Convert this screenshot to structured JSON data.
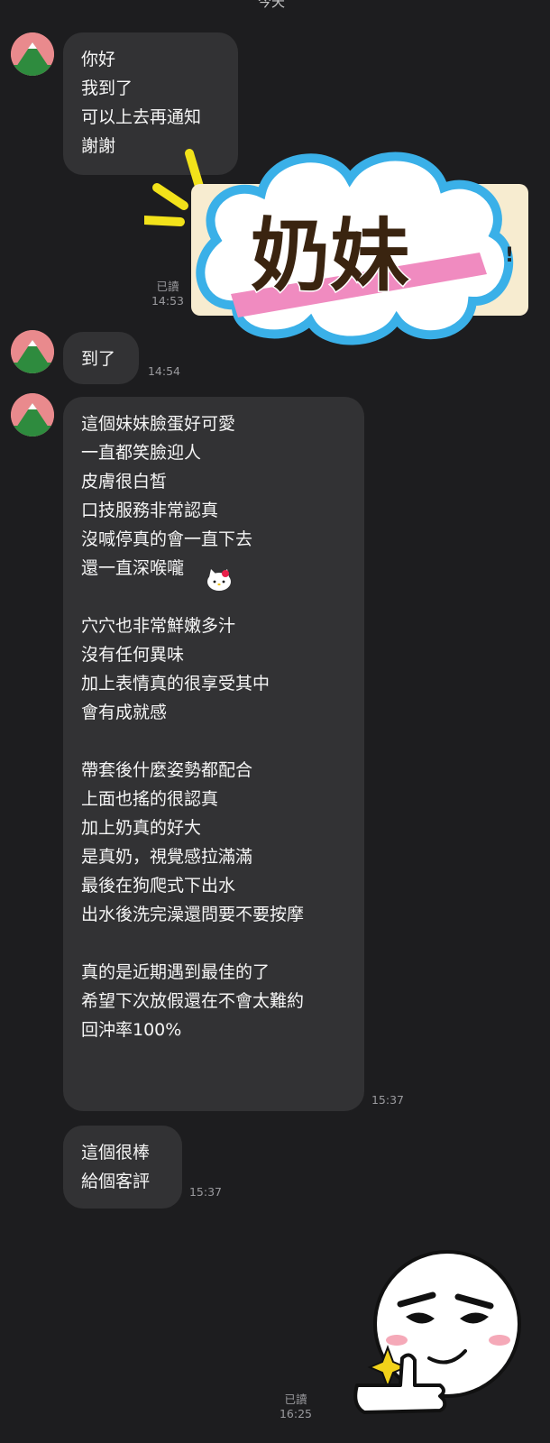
{
  "chat": {
    "top_fragment": "今天",
    "messages": [
      {
        "text": "你好\n我到了\n可以上去再通知\n謝謝",
        "read": "",
        "time": ""
      },
      {
        "sticker_text": "奶妹",
        "sticker_exclaim": "!",
        "read": "已讀",
        "time": "14:53"
      },
      {
        "text": "到了",
        "time": "14:54"
      },
      {
        "text": "這個妹妹臉蛋好可愛\n一直都笑臉迎人\n皮膚很白皙\n口技服務非常認真\n沒喊停真的會一直下去\n還一直深喉嚨\n\n穴穴也非常鮮嫩多汁\n沒有任何異味\n加上表情真的很享受其中\n會有成就感\n\n帶套後什麼姿勢都配合\n上面也搖的很認真\n加上奶真的好大\n是真奶，視覺感拉滿滿\n最後在狗爬式下出水\n出水後洗完澡還問要不要按摩\n\n真的是近期遇到最佳的了\n希望下次放假還在不會太難約\n回沖率100%",
        "time": "15:37"
      },
      {
        "text": "這個很棒\n給個客評",
        "time": "15:37"
      },
      {
        "sticker": "thumbs-up-face",
        "read": "已讀",
        "time": "16:25"
      }
    ]
  },
  "colors": {
    "background": "#1d1d1f",
    "bubble": "#323234",
    "avatar_bg": "#e98a8d",
    "avatar_mountain": "#2e8b3e",
    "sticker_outline": "#3ab0e8",
    "sticker_text": "#3a2410",
    "sticker_pink": "#f08bc0"
  }
}
